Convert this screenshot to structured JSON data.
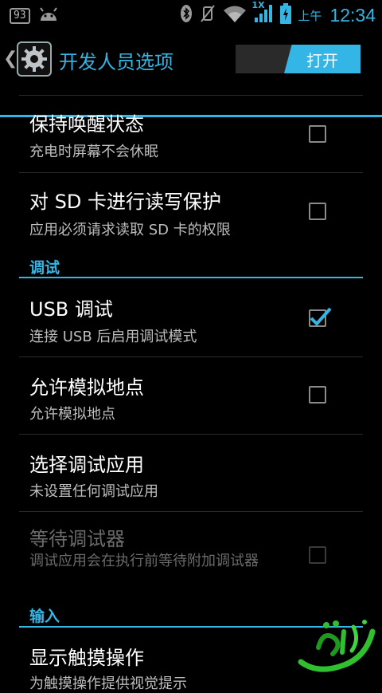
{
  "status_bar": {
    "notification_count": "93",
    "network_type": "1X",
    "ampm": "上午",
    "time": "12:34"
  },
  "action_bar": {
    "title": "开发人员选项",
    "switch_label": "打开"
  },
  "preferences": {
    "stay_awake": {
      "title": "保持唤醒状态",
      "summary": "充电时屏幕不会休眠",
      "checked": false
    },
    "protect_sd": {
      "title": "对 SD 卡进行读写保护",
      "summary": "应用必须请求读取 SD 卡的权限",
      "checked": false
    },
    "debug_category": "调试",
    "usb_debug": {
      "title": "USB 调试",
      "summary": "连接 USB 后启用调试模式",
      "checked": true
    },
    "mock_location": {
      "title": "允许模拟地点",
      "summary": "允许模拟地点",
      "checked": false
    },
    "debug_app": {
      "title": "选择调试应用",
      "summary": "未设置任何调试应用"
    },
    "wait_debugger": {
      "title": "等待调试器",
      "summary": "调试应用会在执行前等待附加调试器",
      "checked": false,
      "enabled": false
    },
    "input_category": "输入",
    "show_touches": {
      "title": "显示触摸操作",
      "summary": "为触摸操作提供视觉提示"
    }
  },
  "colors": {
    "accent": "#33b5e5",
    "background": "#000000",
    "watermark_green": "#2fbf2f"
  }
}
